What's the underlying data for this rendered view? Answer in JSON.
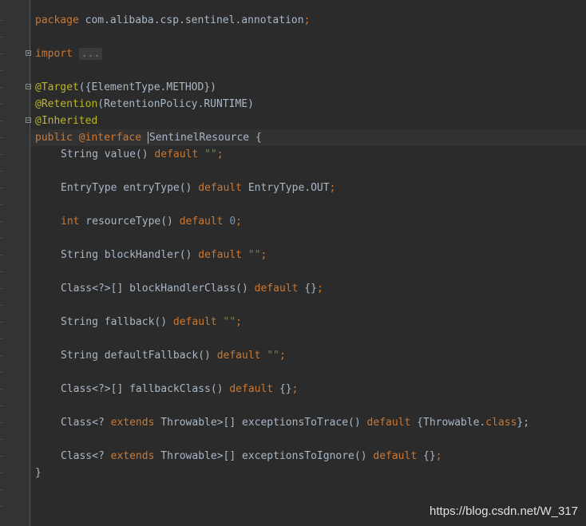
{
  "code": {
    "package_kw": "package",
    "package_name": " com.alibaba.csp.sentinel.annotation",
    "semicolon": ";",
    "import_kw": "import",
    "import_folded": "...",
    "ann_target": "@Target",
    "ann_target_args": "({ElementType.METHOD})",
    "ann_retention": "@Retention",
    "ann_retention_args": "(RetentionPolicy.RUNTIME)",
    "ann_inherited": "@Inherited",
    "public_kw": "public",
    "interface_kw": "@interface",
    "class_name": "SentinelResource",
    "open_brace": " {",
    "close_brace": "}",
    "default_kw": "default",
    "extends_kw": "extends",
    "class_kw": "class",
    "int_kw": "int",
    "empty_string": "\"\"",
    "zero": "0",
    "members": {
      "value": {
        "type": "String",
        "name": " value()"
      },
      "entryType": {
        "type": "EntryType",
        "name": " entryType()",
        "default_value": " EntryType.OUT"
      },
      "resourceType": {
        "name": " resourceType()"
      },
      "blockHandler": {
        "type": "String",
        "name": " blockHandler()"
      },
      "blockHandlerClass": {
        "type": "Class<?>[]",
        "name": " blockHandlerClass()",
        "default_value": " {}"
      },
      "fallback": {
        "type": "String",
        "name": " fallback()"
      },
      "defaultFallback": {
        "type": "String",
        "name": " defaultFallback()"
      },
      "fallbackClass": {
        "type": "Class<?>[]",
        "name": " fallbackClass()",
        "default_value": " {}"
      },
      "exceptionsToTrace": {
        "type_start": "Class<? ",
        "type_end": " Throwable>[]",
        "name": " exceptionsToTrace()",
        "default_open": " {Throwable.",
        "default_close": "};"
      },
      "exceptionsToIgnore": {
        "type_start": "Class<? ",
        "type_end": " Throwable>[]",
        "name": " exceptionsToIgnore()",
        "default_value": " {}"
      }
    }
  },
  "watermark": "https://blog.csdn.net/W_317"
}
